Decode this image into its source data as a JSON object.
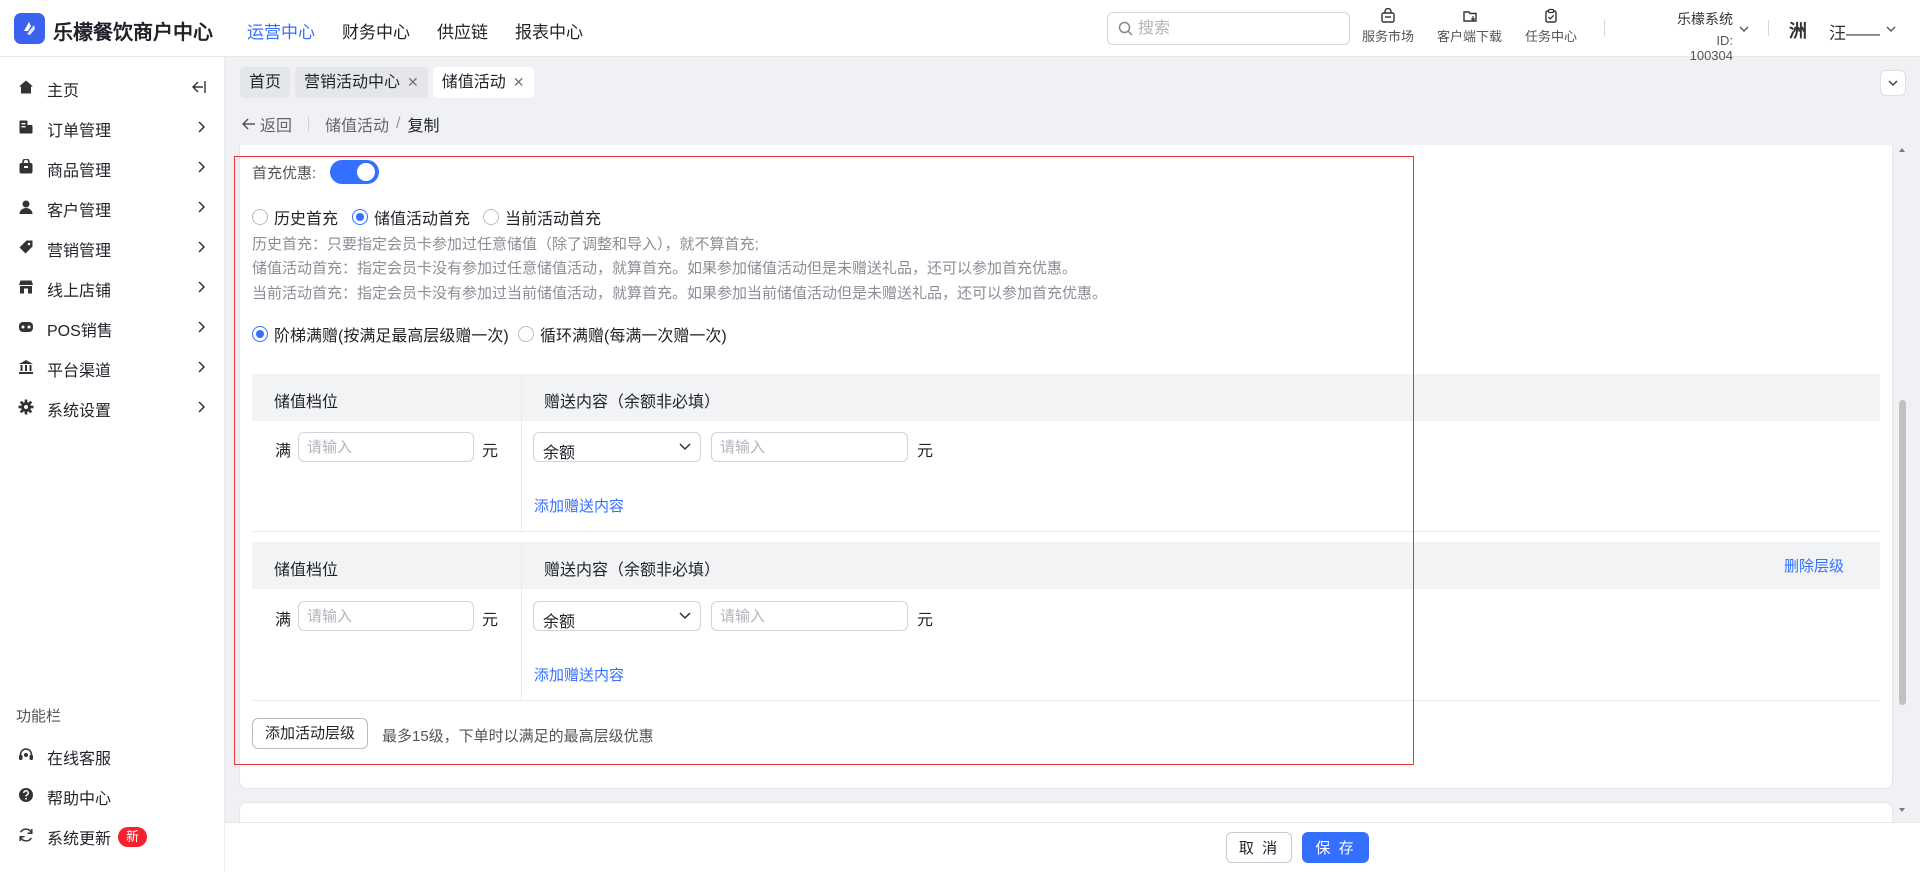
{
  "app": {
    "brand": "乐檬餐饮商户中心",
    "accent": "#3370ff"
  },
  "topnav": [
    {
      "label": "运营中心",
      "active": true
    },
    {
      "label": "财务中心"
    },
    {
      "label": "供应链"
    },
    {
      "label": "报表中心"
    }
  ],
  "search": {
    "placeholder": "搜索"
  },
  "tools": [
    {
      "label": "服务市场",
      "icon": "store-icon"
    },
    {
      "label": "客户端下载",
      "icon": "download-icon"
    },
    {
      "label": "任务中心",
      "icon": "task-icon"
    }
  ],
  "account": {
    "system": "乐檬系统",
    "id": "ID: 100304",
    "avatar_text": "洲",
    "user": "汪——"
  },
  "sidebar": {
    "items": [
      {
        "label": "主页",
        "icon": "home-icon"
      },
      {
        "label": "订单管理",
        "icon": "order-icon"
      },
      {
        "label": "商品管理",
        "icon": "goods-icon"
      },
      {
        "label": "客户管理",
        "icon": "user-icon"
      },
      {
        "label": "营销管理",
        "icon": "tag-icon"
      },
      {
        "label": "线上店铺",
        "icon": "shop-icon"
      },
      {
        "label": "POS销售",
        "icon": "pos-icon"
      },
      {
        "label": "平台渠道",
        "icon": "bank-icon"
      },
      {
        "label": "系统设置",
        "icon": "gear-icon"
      }
    ],
    "section_title": "功能栏",
    "tools": [
      {
        "label": "在线客服",
        "icon": "headset-icon"
      },
      {
        "label": "帮助中心",
        "icon": "help-icon"
      },
      {
        "label": "系统更新",
        "icon": "refresh-icon",
        "badge": "新"
      }
    ]
  },
  "tabs": [
    {
      "label": "首页",
      "closable": false
    },
    {
      "label": "营销活动中心",
      "closable": true
    },
    {
      "label": "储值活动",
      "closable": true,
      "active": true
    }
  ],
  "breadcrumb": {
    "back": "返回",
    "parent": "储值活动",
    "sep": "/",
    "current": "复制"
  },
  "form": {
    "first_recharge_label": "首充优惠:",
    "first_recharge_on": true,
    "first_options": [
      {
        "label": "历史首充",
        "checked": false
      },
      {
        "label": "储值活动首充",
        "checked": true
      },
      {
        "label": "当前活动首充",
        "checked": false
      }
    ],
    "help": [
      "历史首充：只要指定会员卡参加过任意储值（除了调整和导入），就不算首充;",
      "储值活动首充：指定会员卡没有参加过任意储值活动，就算首充。如果参加储值活动但是未赠送礼品，还可以参加首充优惠。",
      "当前活动首充：指定会员卡没有参加过当前储值活动，就算首充。如果参加当前储值活动但是未赠送礼品，还可以参加首充优惠。"
    ],
    "mode_options": [
      {
        "label": "阶梯满赠(按满足最高层级赠一次)",
        "checked": true
      },
      {
        "label": "循环满赠(每满一次赠一次)",
        "checked": false
      }
    ],
    "tiers": [
      {
        "col1": "储值档位",
        "col2": "赠送内容（余额非必填）",
        "delete": "",
        "man": "满",
        "amount_placeholder": "请输入",
        "unit": "元",
        "gift_type": "余额",
        "gift_placeholder": "请输入",
        "gift_unit": "元",
        "add_gift": "添加赠送内容"
      },
      {
        "col1": "储值档位",
        "col2": "赠送内容（余额非必填）",
        "delete": "删除层级",
        "man": "满",
        "amount_placeholder": "请输入",
        "unit": "元",
        "gift_type": "余额",
        "gift_placeholder": "请输入",
        "gift_unit": "元",
        "add_gift": "添加赠送内容"
      }
    ],
    "add_tier_button": "添加活动层级",
    "add_tier_hint": "最多15级，下单时以满足的最高层级优惠"
  },
  "footer": {
    "cancel": "取 消",
    "save": "保 存"
  }
}
